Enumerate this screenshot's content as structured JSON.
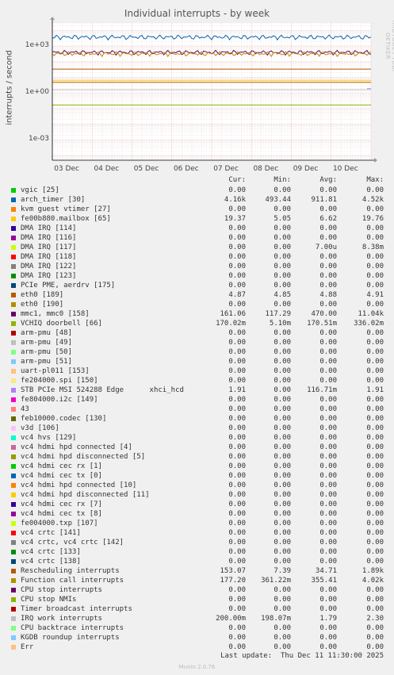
{
  "chart_data": {
    "type": "line",
    "title": "Individual interrupts - by week",
    "ylabel": "interrupts / second",
    "yscale": "log",
    "ylim": [
      5e-05,
      30000
    ],
    "yticks": [
      "1e+03",
      "1e+00",
      "1e-03"
    ],
    "ytick_values": [
      1000,
      1,
      0.001
    ],
    "xticks": [
      "03 Dec",
      "04 Dec",
      "05 Dec",
      "06 Dec",
      "07 Dec",
      "08 Dec",
      "09 Dec",
      "10 Dec"
    ],
    "xlim_days": [
      0,
      8
    ],
    "grid": true,
    "columns": [
      "Cur:",
      "Min:",
      "Avg:",
      "Max:"
    ],
    "series": [
      {
        "name": "vgic [25]",
        "color": "#00cc00",
        "cur": "0.00",
        "min": "0.00",
        "avg": "0.00",
        "max": "0.00",
        "start": 0,
        "level": 0
      },
      {
        "name": "arch_timer [30]",
        "color": "#0066b3",
        "cur": "4.16k",
        "min": "493.44",
        "avg": "911.81",
        "max": "4.52k",
        "start": 0,
        "level": 3800
      },
      {
        "name": "kvm guest vtimer [27]",
        "color": "#ff8000",
        "cur": "0.00",
        "min": "0.00",
        "avg": "0.00",
        "max": "0.00",
        "start": 0,
        "level": 0
      },
      {
        "name": "fe00b880.mailbox [65]",
        "color": "#ffcc00",
        "cur": "19.37",
        "min": "5.05",
        "avg": "6.62",
        "max": "19.76",
        "start": 0,
        "level": 6.5
      },
      {
        "name": "DMA IRQ [114]",
        "color": "#330099",
        "cur": "0.00",
        "min": "0.00",
        "avg": "0.00",
        "max": "0.00",
        "start": 0,
        "level": 0
      },
      {
        "name": "DMA IRQ [116]",
        "color": "#990099",
        "cur": "0.00",
        "min": "0.00",
        "avg": "0.00",
        "max": "0.00",
        "start": 0,
        "level": 0
      },
      {
        "name": "DMA IRQ [117]",
        "color": "#ccff00",
        "cur": "0.00",
        "min": "0.00",
        "avg": "7.00u",
        "max": "8.38m",
        "start": 0,
        "level": 0
      },
      {
        "name": "DMA IRQ [118]",
        "color": "#ff0000",
        "cur": "0.00",
        "min": "0.00",
        "avg": "0.00",
        "max": "0.00",
        "start": 0,
        "level": 0
      },
      {
        "name": "DMA IRQ [122]",
        "color": "#808080",
        "cur": "0.00",
        "min": "0.00",
        "avg": "0.00",
        "max": "0.00",
        "start": 0,
        "level": 0
      },
      {
        "name": "DMA IRQ [123]",
        "color": "#008f00",
        "cur": "0.00",
        "min": "0.00",
        "avg": "0.00",
        "max": "0.00",
        "start": 0,
        "level": 0
      },
      {
        "name": "PCIe PME, aerdrv [175]",
        "color": "#00487d",
        "cur": "0.00",
        "min": "0.00",
        "avg": "0.00",
        "max": "0.00",
        "start": 0,
        "level": 0
      },
      {
        "name": "eth0 [189]",
        "color": "#b35a00",
        "cur": "4.87",
        "min": "4.85",
        "avg": "4.88",
        "max": "4.91",
        "start": 0,
        "level": 4.88
      },
      {
        "name": "eth0 [190]",
        "color": "#b38f00",
        "cur": "0.00",
        "min": "0.00",
        "avg": "0.00",
        "max": "0.00",
        "start": 0,
        "level": 0
      },
      {
        "name": "mmc1, mmc0 [158]",
        "color": "#6b006b",
        "cur": "161.06",
        "min": "117.29",
        "avg": "470.00",
        "max": "11.04k",
        "start": 0,
        "level": 400
      },
      {
        "name": "VCHIQ doorbell [66]",
        "color": "#8fb300",
        "cur": "170.02m",
        "min": "5.10m",
        "avg": "170.51m",
        "max": "336.02m",
        "start": 0,
        "level": 0.17
      },
      {
        "name": "arm-pmu [48]",
        "color": "#b30000",
        "cur": "0.00",
        "min": "0.00",
        "avg": "0.00",
        "max": "0.00",
        "start": 0,
        "level": 0
      },
      {
        "name": "arm-pmu [49]",
        "color": "#bebebe",
        "cur": "0.00",
        "min": "0.00",
        "avg": "0.00",
        "max": "0.00",
        "start": 0,
        "level": 0
      },
      {
        "name": "arm-pmu [50]",
        "color": "#80ff80",
        "cur": "0.00",
        "min": "0.00",
        "avg": "0.00",
        "max": "0.00",
        "start": 0,
        "level": 0
      },
      {
        "name": "arm-pmu [51]",
        "color": "#80c9ff",
        "cur": "0.00",
        "min": "0.00",
        "avg": "0.00",
        "max": "0.00",
        "start": 0,
        "level": 0
      },
      {
        "name": "uart-pl011 [153]",
        "color": "#ffc080",
        "cur": "0.00",
        "min": "0.00",
        "avg": "0.00",
        "max": "0.00",
        "start": 0,
        "level": 0
      },
      {
        "name": "fe204000.spi [150]",
        "color": "#ffe680",
        "cur": "0.00",
        "min": "0.00",
        "avg": "0.00",
        "max": "0.00",
        "start": 0,
        "level": 0
      },
      {
        "name": "STB PCIe MSI 524288 Edge      xhci_hcd",
        "color": "#aa80ff",
        "cur": "1.91",
        "min": "0.00",
        "avg": "116.71m",
        "max": "1.91",
        "start": 7.9,
        "level": 1.91
      },
      {
        "name": "fe804000.i2c [149]",
        "color": "#ee00cc",
        "cur": "0.00",
        "min": "0.00",
        "avg": "0.00",
        "max": "0.00",
        "start": 0,
        "level": 0
      },
      {
        "name": "43",
        "color": "#ff8080",
        "cur": "0.00",
        "min": "0.00",
        "avg": "0.00",
        "max": "0.00",
        "start": 0,
        "level": 0
      },
      {
        "name": "feb10000.codec [130]",
        "color": "#666600",
        "cur": "0.00",
        "min": "0.00",
        "avg": "0.00",
        "max": "0.00",
        "start": 0,
        "level": 0
      },
      {
        "name": "v3d [106]",
        "color": "#ffbfff",
        "cur": "0.00",
        "min": "0.00",
        "avg": "0.00",
        "max": "0.00",
        "start": 0,
        "level": 0
      },
      {
        "name": "vc4 hvs [129]",
        "color": "#00ffcc",
        "cur": "0.00",
        "min": "0.00",
        "avg": "0.00",
        "max": "0.00",
        "start": 0,
        "level": 0
      },
      {
        "name": "vc4 hdmi hpd connected [4]",
        "color": "#cc6699",
        "cur": "0.00",
        "min": "0.00",
        "avg": "0.00",
        "max": "0.00",
        "start": 0,
        "level": 0
      },
      {
        "name": "vc4 hdmi hpd disconnected [5]",
        "color": "#999900",
        "cur": "0.00",
        "min": "0.00",
        "avg": "0.00",
        "max": "0.00",
        "start": 0,
        "level": 0
      },
      {
        "name": "vc4 hdmi cec rx [1]",
        "color": "#00cc00",
        "cur": "0.00",
        "min": "0.00",
        "avg": "0.00",
        "max": "0.00",
        "start": 0,
        "level": 0
      },
      {
        "name": "vc4 hdmi cec tx [0]",
        "color": "#0066b3",
        "cur": "0.00",
        "min": "0.00",
        "avg": "0.00",
        "max": "0.00",
        "start": 0,
        "level": 0
      },
      {
        "name": "vc4 hdmi hpd connected [10]",
        "color": "#ff8000",
        "cur": "0.00",
        "min": "0.00",
        "avg": "0.00",
        "max": "0.00",
        "start": 0,
        "level": 0
      },
      {
        "name": "vc4 hdmi hpd disconnected [11]",
        "color": "#ffcc00",
        "cur": "0.00",
        "min": "0.00",
        "avg": "0.00",
        "max": "0.00",
        "start": 0,
        "level": 0
      },
      {
        "name": "vc4 hdmi cec rx [7]",
        "color": "#330099",
        "cur": "0.00",
        "min": "0.00",
        "avg": "0.00",
        "max": "0.00",
        "start": 0,
        "level": 0
      },
      {
        "name": "vc4 hdmi cec tx [8]",
        "color": "#990099",
        "cur": "0.00",
        "min": "0.00",
        "avg": "0.00",
        "max": "0.00",
        "start": 0,
        "level": 0
      },
      {
        "name": "fe004000.txp [107]",
        "color": "#ccff00",
        "cur": "0.00",
        "min": "0.00",
        "avg": "0.00",
        "max": "0.00",
        "start": 0,
        "level": 0
      },
      {
        "name": "vc4 crtc [141]",
        "color": "#ff0000",
        "cur": "0.00",
        "min": "0.00",
        "avg": "0.00",
        "max": "0.00",
        "start": 0,
        "level": 0
      },
      {
        "name": "vc4 crtc, vc4 crtc [142]",
        "color": "#808080",
        "cur": "0.00",
        "min": "0.00",
        "avg": "0.00",
        "max": "0.00",
        "start": 0,
        "level": 0
      },
      {
        "name": "vc4 crtc [133]",
        "color": "#008f00",
        "cur": "0.00",
        "min": "0.00",
        "avg": "0.00",
        "max": "0.00",
        "start": 0,
        "level": 0
      },
      {
        "name": "vc4 crtc [138]",
        "color": "#00487d",
        "cur": "0.00",
        "min": "0.00",
        "avg": "0.00",
        "max": "0.00",
        "start": 0,
        "level": 0
      },
      {
        "name": "Rescheduling interrupts",
        "color": "#b35a00",
        "cur": "153.07",
        "min": "7.39",
        "avg": "34.71",
        "max": "1.89k",
        "start": 0,
        "level": 34
      },
      {
        "name": "Function call interrupts",
        "color": "#b38f00",
        "cur": "177.20",
        "min": "361.22m",
        "avg": "355.41",
        "max": "4.02k",
        "start": 0,
        "level": 330
      },
      {
        "name": "CPU stop interrupts",
        "color": "#6b006b",
        "cur": "0.00",
        "min": "0.00",
        "avg": "0.00",
        "max": "0.00",
        "start": 0,
        "level": 0
      },
      {
        "name": "CPU stop NMIs",
        "color": "#8fb300",
        "cur": "0.00",
        "min": "0.00",
        "avg": "0.00",
        "max": "0.00",
        "start": 0,
        "level": 0
      },
      {
        "name": "Timer broadcast interrupts",
        "color": "#b30000",
        "cur": "0.00",
        "min": "0.00",
        "avg": "0.00",
        "max": "0.00",
        "start": 0,
        "level": 0
      },
      {
        "name": "IRQ work interrupts",
        "color": "#bebebe",
        "cur": "200.00m",
        "min": "198.07m",
        "avg": "1.79",
        "max": "2.30",
        "start": 0,
        "level": 1.6
      },
      {
        "name": "CPU backtrace interrupts",
        "color": "#80ff80",
        "cur": "0.00",
        "min": "0.00",
        "avg": "0.00",
        "max": "0.00",
        "start": 0,
        "level": 0
      },
      {
        "name": "KGDB roundup interrupts",
        "color": "#80c9ff",
        "cur": "0.00",
        "min": "0.00",
        "avg": "0.00",
        "max": "0.00",
        "start": 0,
        "level": 0
      },
      {
        "name": "Err",
        "color": "#ffc080",
        "cur": "0.00",
        "min": "0.00",
        "avg": "0.00",
        "max": "0.00",
        "start": 0,
        "level": 0
      }
    ]
  },
  "side_text": "RRDTOOL / TOBI OETIKER",
  "last_update": "Last update:  Thu Dec 11 11:30:00 2025",
  "footer": "Munin 2.0.76"
}
